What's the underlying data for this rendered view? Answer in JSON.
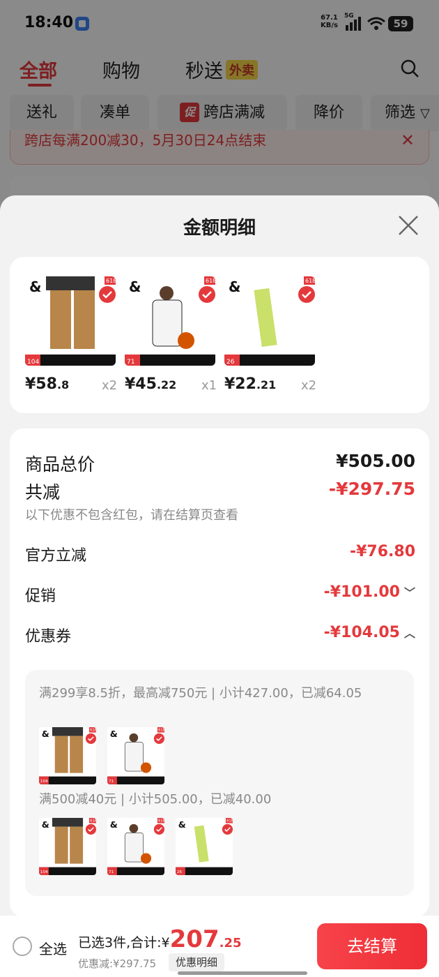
{
  "status_bar": {
    "time": "18:40",
    "net_speed_value": "67.1",
    "net_speed_unit": "KB/s",
    "network": "5G",
    "battery": "59"
  },
  "top_tabs": {
    "all": "全部",
    "shopping": "购物",
    "express": "秒送",
    "takeout_badge": "外卖"
  },
  "filters": {
    "gift": "送礼",
    "bundle": "凑单",
    "promo_badge": "促",
    "cross_store": "跨店满减",
    "price_drop": "降价",
    "filter": "筛选"
  },
  "promo_banner": {
    "text": "跨店每满200减30，5月30日24点结束"
  },
  "sheet": {
    "title": "金额明细",
    "products": [
      {
        "price_int": "¥58",
        "price_dec": ".8",
        "qty": "x2",
        "tag": "618",
        "sales": "104",
        "color": "#b8864a"
      },
      {
        "price_int": "¥45",
        "price_dec": ".22",
        "qty": "x1",
        "tag": "618",
        "sales": "71",
        "color": "#2a2a2a"
      },
      {
        "price_int": "¥22",
        "price_dec": ".21",
        "qty": "x2",
        "tag": "618",
        "sales": "26",
        "color": "#c9e06a"
      }
    ],
    "total_label": "商品总价",
    "total_value": "¥505.00",
    "reduction_label": "共减",
    "reduction_value": "-¥297.75",
    "note": "以下优惠不包含红包，请在结算页查看",
    "official_label": "官方立减",
    "official_value": "-¥76.80",
    "promo_label": "促销",
    "promo_value": "-¥101.00",
    "coupon_label": "优惠券",
    "coupon_value": "-¥104.05",
    "coupon_rule_1": "满299享8.5折，最高减750元 | 小计427.00，已减64.05",
    "coupon_rule_2": "满500减40元 | 小计505.00，已减40.00"
  },
  "bottom_bar": {
    "select_all": "全选",
    "selected_prefix": "已选3件,合计:",
    "currency": "¥",
    "amount": "207",
    "cents": ".25",
    "saved": "优惠减:¥297.75",
    "detail_link": "优惠明细",
    "checkout": "去结算"
  },
  "colors": {
    "accent": "#e4393c",
    "sheet_bg": "#f2f2f2"
  }
}
